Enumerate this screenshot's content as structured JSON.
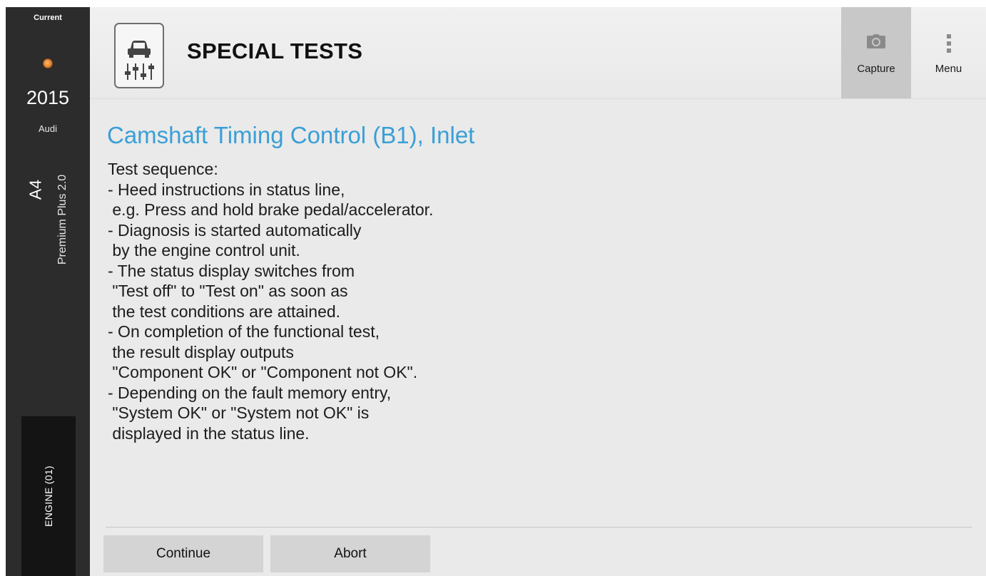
{
  "sidebar": {
    "current_label": "Current",
    "year": "2015",
    "make": "Audi",
    "model": "A4",
    "trim": "Premium Plus 2.0",
    "module": "ENGINE (01)"
  },
  "header": {
    "title": "SPECIAL TESTS",
    "capture_label": "Capture",
    "menu_label": "Menu",
    "icons": {
      "logo": "car-lift-sliders-icon",
      "capture": "camera-icon",
      "menu": "vertical-dots-icon"
    }
  },
  "content": {
    "title": "Camshaft Timing Control (B1), Inlet",
    "lines": [
      "Test sequence:",
      "- Heed instructions in status line,",
      " e.g. Press and hold brake pedal/accelerator.",
      "- Diagnosis is started automatically",
      " by the engine control unit.",
      "- The status display switches from",
      " \"Test off\" to \"Test on\" as soon as",
      " the test conditions are attained.",
      "- On completion of the functional test,",
      " the result display outputs",
      " \"Component OK\" or \"Component not OK\".",
      "- Depending on the fault memory entry,",
      " \"System OK\" or \"System not OK\" is",
      " displayed in the status line."
    ]
  },
  "footer": {
    "continue_label": "Continue",
    "abort_label": "Abort"
  },
  "colors": {
    "accent_title": "#3a9fd6",
    "rail_bg": "#2c2c2c",
    "module_bg": "#141414",
    "header_bg": "#eeeeee",
    "capture_bg": "#c8c8c8",
    "content_bg": "#eaeaea",
    "button_bg": "#d4d4d4"
  }
}
